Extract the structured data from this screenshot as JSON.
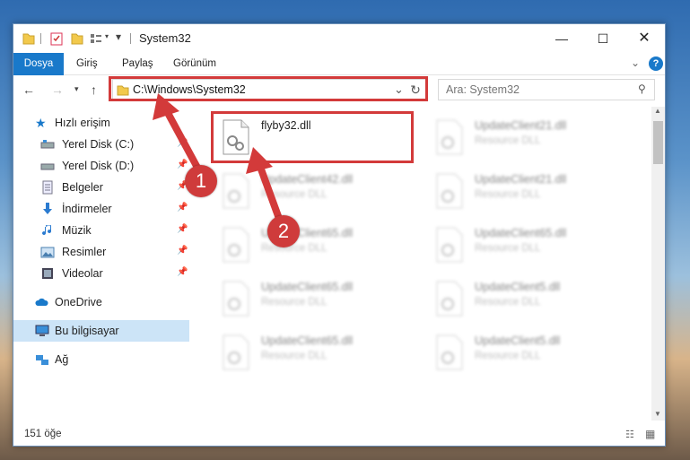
{
  "window": {
    "title": "System32"
  },
  "ribbon": {
    "tabs": [
      "Dosya",
      "Giriş",
      "Paylaş",
      "Görünüm"
    ]
  },
  "address": {
    "path": "C:\\Windows\\System32"
  },
  "search": {
    "placeholder": "Ara: System32"
  },
  "sidebar": {
    "quick_access": "Hızlı erişim",
    "items": [
      {
        "label": "Yerel Disk (C:)",
        "icon": "drive-icon"
      },
      {
        "label": "Yerel Disk (D:)",
        "icon": "drive-icon"
      },
      {
        "label": "Belgeler",
        "icon": "documents-icon"
      },
      {
        "label": "İndirmeler",
        "icon": "downloads-icon"
      },
      {
        "label": "Müzik",
        "icon": "music-icon"
      },
      {
        "label": "Resimler",
        "icon": "pictures-icon"
      },
      {
        "label": "Videolar",
        "icon": "videos-icon"
      }
    ],
    "onedrive": "OneDrive",
    "this_pc": "Bu bilgisayar",
    "network": "Ağ"
  },
  "files": {
    "highlighted": {
      "name": "flyby32.dll",
      "type": ""
    },
    "left_column": [
      {
        "name": "UpdateClient42.dll",
        "type": "Resource DLL"
      },
      {
        "name": "UpdateClient65.dll",
        "type": "Resource DLL"
      },
      {
        "name": "UpdateClient65.dll",
        "type": "Resource DLL"
      },
      {
        "name": "UpdateClient65.dll",
        "type": "Resource DLL"
      }
    ],
    "right_column": [
      {
        "name": "UpdateClient21.dll",
        "type": "Resource DLL"
      },
      {
        "name": "UpdateClient21.dll",
        "type": "Resource DLL"
      },
      {
        "name": "UpdateClient65.dll",
        "type": "Resource DLL"
      },
      {
        "name": "UpdateClient5.dll",
        "type": "Resource DLL"
      },
      {
        "name": "UpdateClient5.dll",
        "type": "Resource DLL"
      }
    ]
  },
  "status": {
    "count": "151 öğe"
  },
  "callouts": {
    "one": "1",
    "two": "2"
  },
  "colors": {
    "accent": "#1979ca",
    "annotation_red": "#d33a3a",
    "selection": "#cce4f7"
  }
}
